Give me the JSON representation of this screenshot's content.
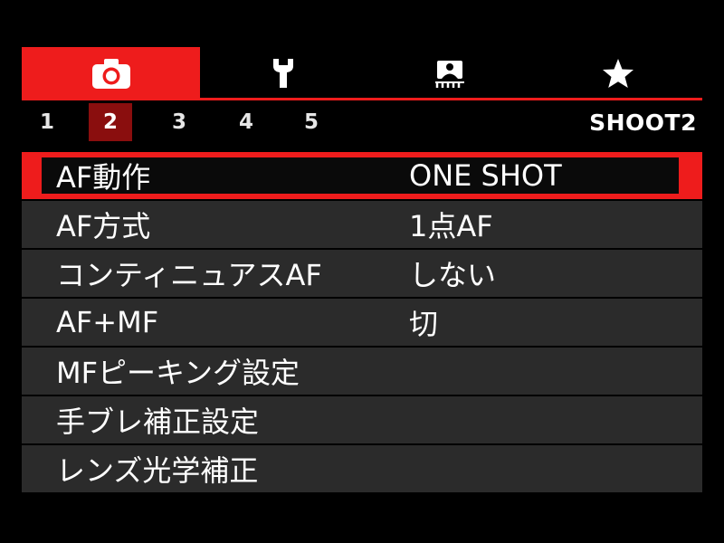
{
  "tabs": [
    {
      "icon": "camera-icon",
      "active": true
    },
    {
      "icon": "wrench-icon",
      "active": false
    },
    {
      "icon": "playback-person-icon",
      "active": false
    },
    {
      "icon": "star-icon",
      "active": false
    }
  ],
  "subtabs": [
    "1",
    "2",
    "3",
    "4",
    "5"
  ],
  "active_subtab": "2",
  "menu_name": "SHOOT2",
  "items": [
    {
      "label": "AF動作",
      "value": "ONE SHOT",
      "selected": true
    },
    {
      "label": "AF方式",
      "value": "1点AF"
    },
    {
      "label": "コンティニュアスAF",
      "value": "しない"
    },
    {
      "label": "AF+MF",
      "value": "切"
    },
    {
      "label": "MFピーキング設定",
      "value": ""
    },
    {
      "label": "手ブレ補正設定",
      "value": ""
    },
    {
      "label": "レンズ光学補正",
      "value": ""
    }
  ],
  "colors": {
    "accent": "#ee1c1c",
    "subtab_active": "#8a0e0e",
    "row_bg": "#2b2b2b"
  }
}
